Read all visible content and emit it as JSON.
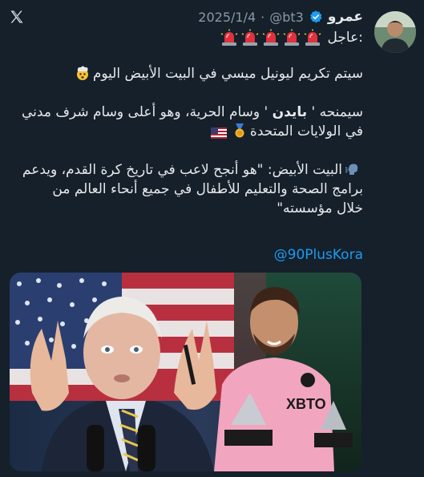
{
  "header": {
    "author_name": "عمرو",
    "handle": "@bt3",
    "separator": "·",
    "date": "2025/1/4"
  },
  "alert": {
    "label": "عاجل:",
    "icon": "siren-icon",
    "icon_count": 5
  },
  "body": {
    "line1": "سيتم تكريم ليونيل ميسي في البيت الأبيض اليوم",
    "line2_pre": "سيمنحه ' ",
    "line2_bold": "بايدن",
    "line2_post": " ' وسام الحرية، وهو أعلى وسام شرف مدني",
    "line3": "في الولايات المتحدة",
    "line4": "البيت الأبيض: \"هو أنجح لاعب في تاريخ كرة القدم، ويدعم",
    "line5": "برامج الصحة والتعليم للأطفال في جميع أنحاء العالم من",
    "line6": "خلال مؤسسته\""
  },
  "mention": "@90PlusKora",
  "media": {
    "jersey_sponsor": "XBTO"
  },
  "colors": {
    "background": "#15202b",
    "text": "#e7e9ea",
    "secondary": "#8b98a5",
    "link": "#1d9bf0",
    "verified": "#1d9bf0"
  }
}
